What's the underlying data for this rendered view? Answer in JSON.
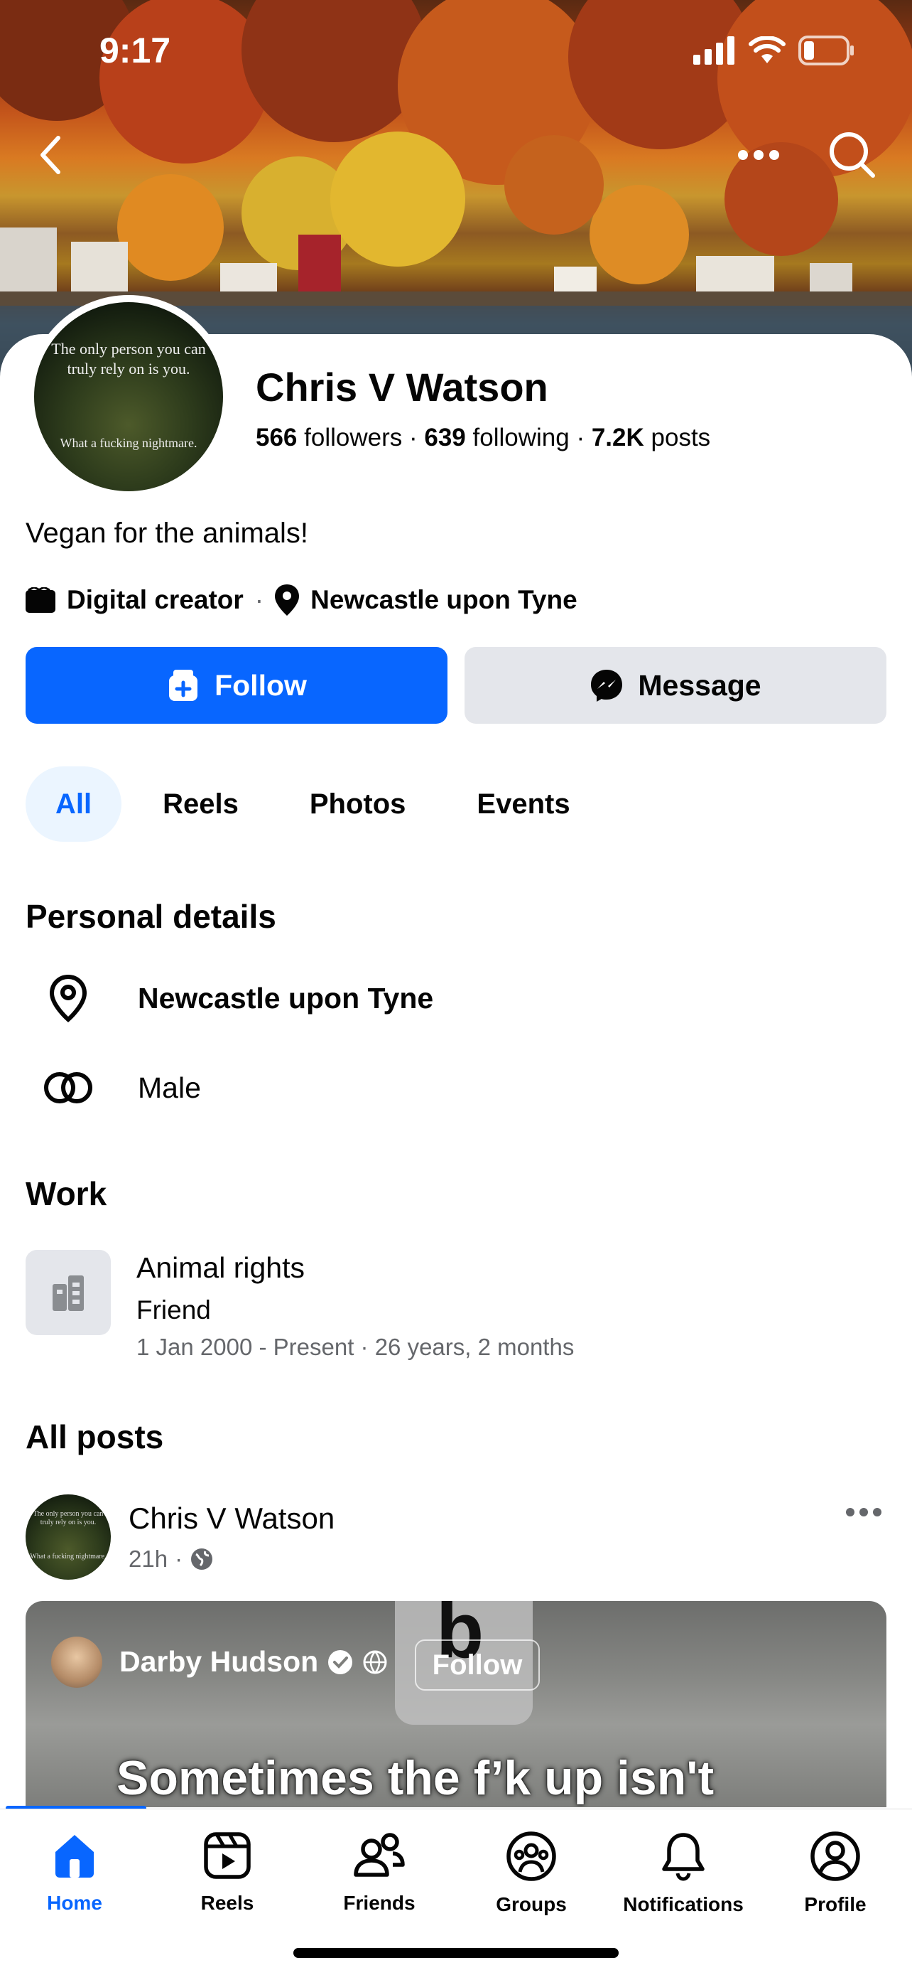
{
  "status_bar": {
    "time": "9:17"
  },
  "header": {
    "back_icon": "chevron-left-icon",
    "more_icon": "more-horizontal-icon",
    "search_icon": "search-icon"
  },
  "profile": {
    "avatar_quote_top": "The only person you can truly rely on is you.",
    "avatar_quote_bottom": "What a fucking nightmare.",
    "name": "Chris V Watson",
    "followers_count": "566",
    "followers_label": "followers",
    "following_count": "639",
    "following_label": "following",
    "posts_count": "7.2K",
    "posts_label": "posts",
    "bio": "Vegan for the animals!",
    "category": "Digital creator",
    "location": "Newcastle upon Tyne"
  },
  "actions": {
    "follow_label": "Follow",
    "message_label": "Message"
  },
  "tabs": [
    {
      "label": "All",
      "active": true
    },
    {
      "label": "Reels",
      "active": false
    },
    {
      "label": "Photos",
      "active": false
    },
    {
      "label": "Events",
      "active": false
    }
  ],
  "personal_details": {
    "title": "Personal details",
    "location": "Newcastle upon Tyne",
    "gender": "Male"
  },
  "work": {
    "title": "Work",
    "org": "Animal rights",
    "role": "Friend",
    "dates": "1 Jan 2000 - Present · 26 years, 2 months"
  },
  "posts": {
    "title": "All posts",
    "author": "Chris V Watson",
    "time": "21h",
    "video": {
      "creator": "Darby Hudson",
      "follow_label": "Follow",
      "letter": "b",
      "caption": "Sometimes the f’k up isn't"
    }
  },
  "bottom_nav": [
    {
      "label": "Home",
      "icon": "home-icon",
      "active": true
    },
    {
      "label": "Reels",
      "icon": "reels-icon",
      "active": false
    },
    {
      "label": "Friends",
      "icon": "friends-icon",
      "active": false
    },
    {
      "label": "Groups",
      "icon": "groups-icon",
      "active": false
    },
    {
      "label": "Notifications",
      "icon": "bell-icon",
      "active": false
    },
    {
      "label": "Profile",
      "icon": "profile-icon",
      "active": false
    }
  ],
  "colors": {
    "accent": "#0866ff",
    "secondary_button": "#e4e6eb",
    "muted_text": "#65676b",
    "active_tab_bg": "#ebf5ff"
  }
}
